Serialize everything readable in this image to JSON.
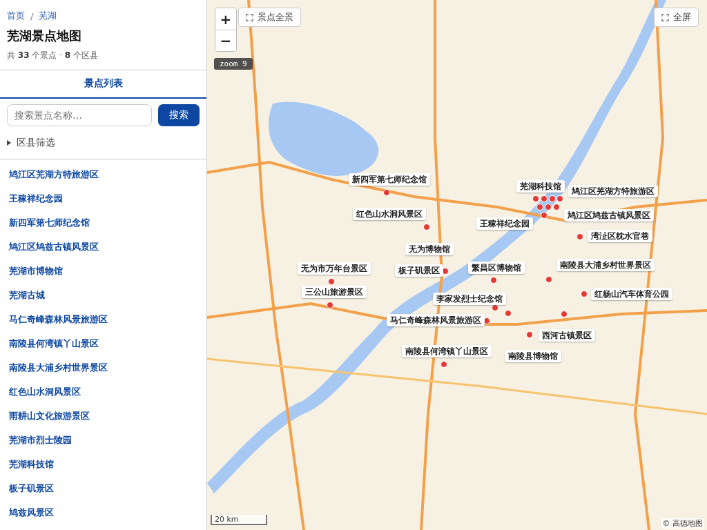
{
  "breadcrumb": [
    {
      "label": "首页"
    },
    {
      "label": "芜湖"
    }
  ],
  "breadcrumb_separator": "/",
  "title": "芜湖景点地图",
  "stats": "共 **33** 个景点 · **8** 个区县",
  "tabs": [
    {
      "label": "景点列表",
      "selected": true
    }
  ],
  "search": {
    "placeholder": "搜索景点名称…",
    "button": "搜索"
  },
  "filter": {
    "label": "区县筛选",
    "expanded": false
  },
  "spots": [
    {
      "name": "鸠江区芜湖方特旅游区"
    },
    {
      "name": "王稼祥纪念园"
    },
    {
      "name": "新四军第七师纪念馆"
    },
    {
      "name": "鸠江区鸠兹古镇风景区"
    },
    {
      "name": "芜湖市博物馆"
    },
    {
      "name": "芜湖古城"
    },
    {
      "name": "马仁奇峰森林风景旅游区"
    },
    {
      "name": "南陵县何湾镇丫山景区"
    },
    {
      "name": "南陵县大浦乡村世界景区"
    },
    {
      "name": "红色山水洞风景区"
    },
    {
      "name": "雨耕山文化旅游景区"
    },
    {
      "name": "芜湖市烈士陵园"
    },
    {
      "name": "芜湖科技馆"
    },
    {
      "name": "板子矶景区"
    },
    {
      "name": "鸠兹风景区"
    }
  ],
  "map": {
    "zoom_in": "+",
    "zoom_out": "−",
    "overview_button": "景点全景",
    "fullscreen_button": "全屏",
    "zoom_label": "zoom 9",
    "scale": "20 km",
    "attribution": "© 高德地图",
    "markers": [
      {
        "label": "新四军第七师纪念馆"
      },
      {
        "label": "红色山水洞风景区"
      },
      {
        "label": "无为博物馆"
      },
      {
        "label": "无为市万年台景区"
      },
      {
        "label": "三公山旅游景区"
      },
      {
        "label": "板子矶景区"
      },
      {
        "label": "繁昌区博物馆"
      },
      {
        "label": "李家发烈士纪念馆"
      },
      {
        "label": "马仁奇峰森林风景旅游区"
      },
      {
        "label": "南陵县何湾镇丫山景区"
      },
      {
        "label": "芜湖科技馆"
      },
      {
        "label": "鸠江区芜湖方特旅游区"
      },
      {
        "label": "鸠江区鸠兹古镇风景区"
      },
      {
        "label": "王稼祥纪念园"
      },
      {
        "label": "湾沚区枕水官巷"
      },
      {
        "label": "南陵县大浦乡村世界景区"
      },
      {
        "label": "红杨山汽车体育公园"
      },
      {
        "label": "西河古镇景区"
      },
      {
        "label": "南陵县博物馆"
      }
    ]
  }
}
